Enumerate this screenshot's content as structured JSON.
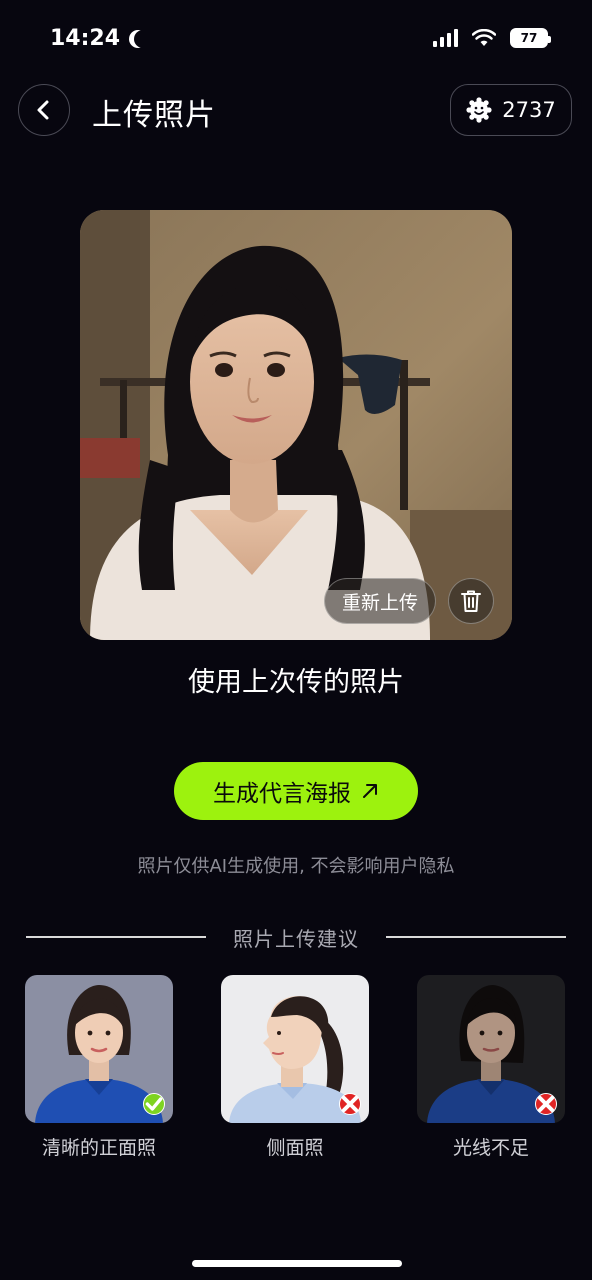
{
  "status_bar": {
    "time": "14:24",
    "battery": "77"
  },
  "header": {
    "title": "上传照片",
    "credits": "2737"
  },
  "photo": {
    "reupload_label": "重新上传"
  },
  "use_last_label": "使用上次传的照片",
  "generate_button": {
    "label": "生成代言海报"
  },
  "privacy_note": "照片仅供AI生成使用, 不会影响用户隐私",
  "tips": {
    "title": "照片上传建议",
    "items": [
      {
        "label": "清晰的正面照",
        "status": "good",
        "badge_color": "#7ed321"
      },
      {
        "label": "侧面照",
        "status": "bad",
        "badge_color": "#e02424"
      },
      {
        "label": "光线不足",
        "status": "bad",
        "badge_color": "#e02424"
      }
    ]
  },
  "colors": {
    "accent": "#9df20e",
    "background": "#07060f"
  }
}
